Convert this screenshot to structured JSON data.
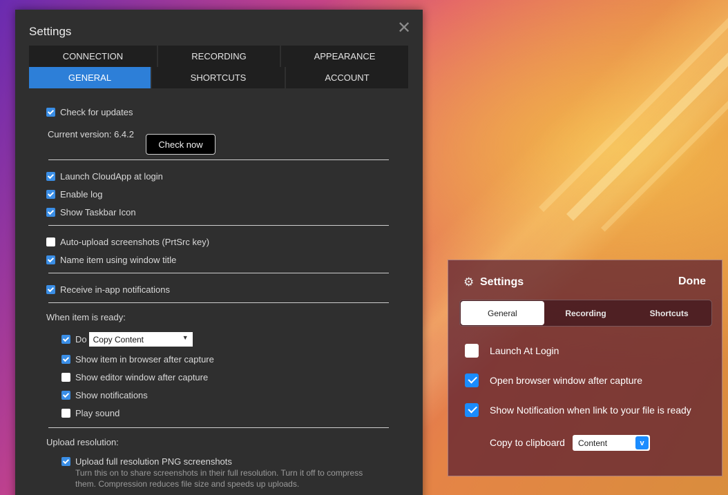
{
  "windows_settings": {
    "title": "Settings",
    "close_glyph": "✕",
    "tabs_row1": [
      "CONNECTION",
      "RECORDING",
      "APPEARANCE"
    ],
    "tabs_row2": [
      "GENERAL",
      "SHORTCUTS",
      "ACCOUNT"
    ],
    "active_tab": "GENERAL",
    "check_for_updates": {
      "label": "Check for updates",
      "checked": true
    },
    "current_version": "Current version: 6.4.2",
    "check_now_label": "Check now",
    "launch_at_login": {
      "label": "Launch CloudApp at login",
      "checked": true
    },
    "enable_log": {
      "label": "Enable log",
      "checked": true
    },
    "show_taskbar_icon": {
      "label": "Show Taskbar Icon",
      "checked": true
    },
    "auto_upload": {
      "label": "Auto-upload screenshots (PrtSrc key)",
      "checked": false
    },
    "name_item": {
      "label": "Name item using window title",
      "checked": true
    },
    "receive_notifications": {
      "label": "Receive in-app notifications",
      "checked": true
    },
    "when_ready_heading": "When item is ready:",
    "do": {
      "label": "Do",
      "checked": true,
      "selected": "Copy Content"
    },
    "show_in_browser": {
      "label": "Show item in browser after capture",
      "checked": true
    },
    "show_editor": {
      "label": "Show editor window after capture",
      "checked": false
    },
    "show_notifications": {
      "label": "Show notifications",
      "checked": true
    },
    "play_sound": {
      "label": "Play sound",
      "checked": false
    },
    "upload_resolution_heading": "Upload resolution:",
    "upload_full_res": {
      "label": "Upload full resolution PNG screenshots",
      "checked": true
    },
    "upload_full_res_desc": "Turn this on to share screenshots in their full resolution. Turn it off to compress them. Compression reduces file size and speeds up uploads."
  },
  "mac_settings": {
    "title": "Settings",
    "gear_icon": "gear-icon",
    "done_label": "Done",
    "tabs": [
      "General",
      "Recording",
      "Shortcuts"
    ],
    "active_tab": "General",
    "launch_at_login": {
      "label": "Launch At Login",
      "checked": false
    },
    "open_browser": {
      "label": "Open browser window after capture",
      "checked": true
    },
    "show_notification": {
      "label": "Show Notification when link to your file is ready",
      "checked": true
    },
    "copy_to_clipboard": {
      "label": "Copy to clipboard",
      "selected": "Content",
      "button": "v"
    }
  },
  "colors": {
    "accent_blue": "#2d7fd8",
    "mac_accent": "#1a8cff",
    "dark_panel": "#2f2f2f"
  }
}
